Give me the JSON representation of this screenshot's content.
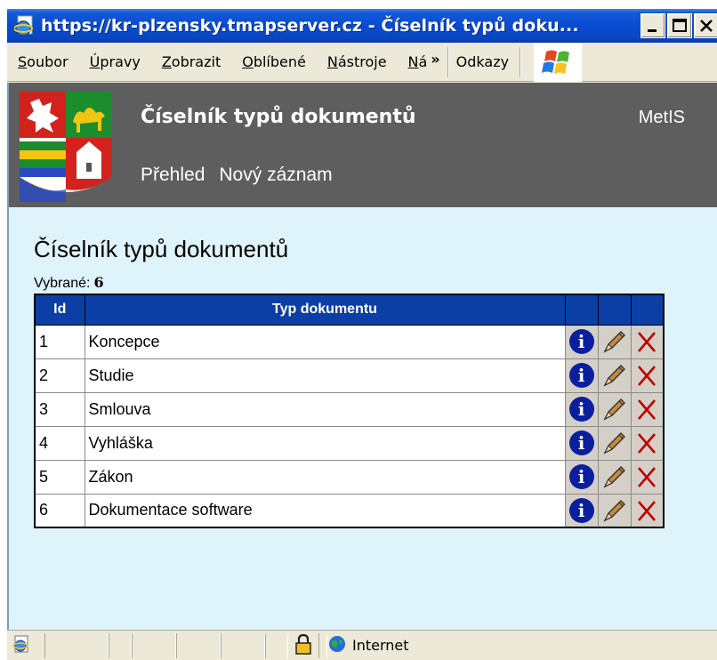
{
  "window": {
    "title": "https://kr-plzensky.tmapserver.cz - Číselník typů doku..."
  },
  "menu": {
    "items": [
      "Soubor",
      "Úpravy",
      "Zobrazit",
      "Oblíbené",
      "Nástroje",
      "Ná"
    ],
    "chevron": "»",
    "links_label": "Odkazy"
  },
  "header": {
    "title": "Číselník typů dokumentů",
    "app_name": "MetIS",
    "nav": [
      "Přehled",
      "Nový záznam"
    ]
  },
  "content": {
    "title": "Číselník typů dokumentů",
    "count_label": "Vybrané:",
    "count_value": "6"
  },
  "table": {
    "headers": [
      "Id",
      "Typ dokumentu"
    ],
    "rows": [
      {
        "id": "1",
        "type": "Koncepce"
      },
      {
        "id": "2",
        "type": "Studie"
      },
      {
        "id": "3",
        "type": "Smlouva"
      },
      {
        "id": "4",
        "type": "Vyhláška"
      },
      {
        "id": "5",
        "type": "Zákon"
      },
      {
        "id": "6",
        "type": "Dokumentace software"
      }
    ],
    "row_actions": [
      "info-icon",
      "edit-pencil-icon",
      "delete-x-icon"
    ]
  },
  "statusbar": {
    "zone": "Internet"
  },
  "colors": {
    "titlebar": "#0a4bd2",
    "header_bg": "#5e5e5e",
    "page_bg": "#dff3fa",
    "table_header": "#0b3fa6",
    "delete": "#c00000"
  }
}
